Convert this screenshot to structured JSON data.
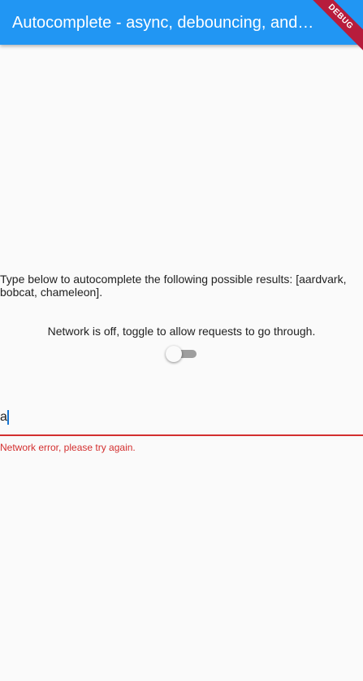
{
  "appbar": {
    "title": "Autocomplete - async, debouncing, and …",
    "debug_banner": "DEBUG",
    "color": "#2196f3"
  },
  "main": {
    "description": "Type below to autocomplete the following possible results: [aardvark, bobcat, chameleon].",
    "network_label": "Network is off, toggle to allow requests to go through.",
    "network_toggle": {
      "on": false
    },
    "search_field": {
      "value": "a",
      "error": "Network error, please try again.",
      "error_color": "#d32f2f",
      "caret_color": "#1976d2"
    }
  }
}
